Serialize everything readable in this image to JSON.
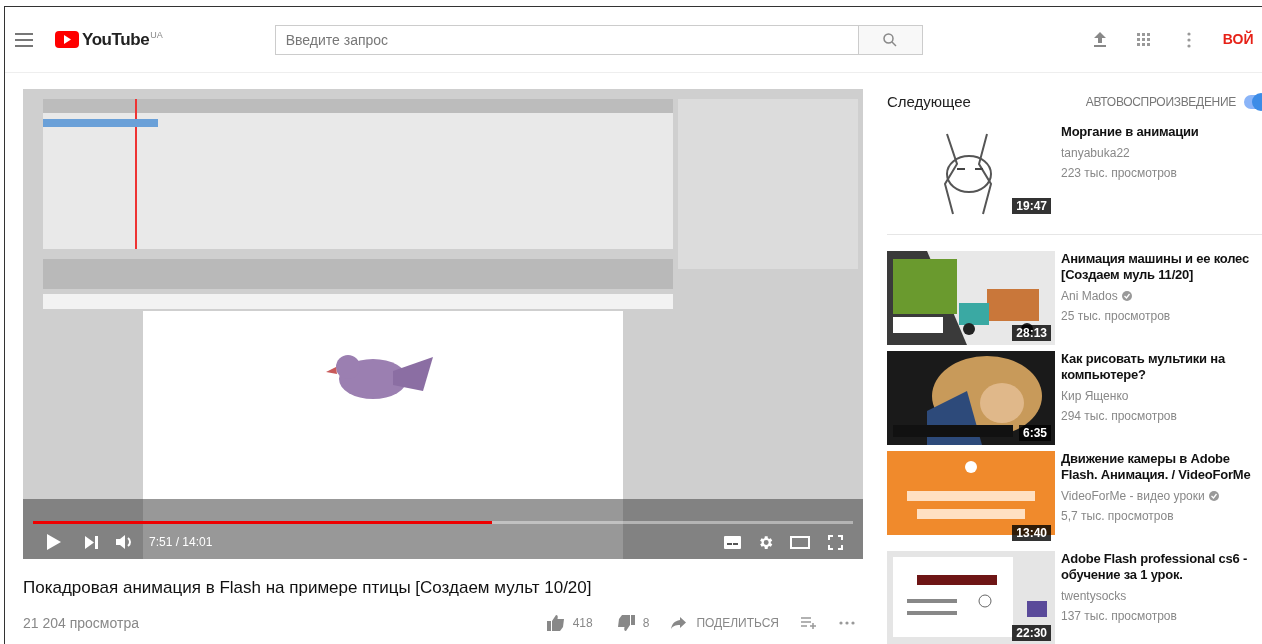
{
  "header": {
    "logo_text": "YouTube",
    "logo_region": "UA",
    "search": {
      "placeholder": "Введите запрос"
    },
    "sign_in": "ВОЙ"
  },
  "player": {
    "progress": {
      "level": 0.56
    },
    "time": "7:51 / 14:01"
  },
  "video": {
    "title": "Покадровая анимация в Flash на примере птицы [Создаем мульт 10/20]",
    "views": "21 204 просмотра",
    "likes": "418",
    "dislikes": "8",
    "share": "ПОДЕЛИТЬСЯ"
  },
  "sidebar": {
    "heading": "Следующее",
    "autoplay": {
      "label": "АВТОВОСПРОИЗВЕДЕНИЕ",
      "on": true
    },
    "items": [
      {
        "title": "Моргание в анимации",
        "channel": "tanyabuka22",
        "verified": false,
        "views": "223 тыс. просмотров",
        "duration": "19:47"
      },
      {
        "title": "Анимация машины и ее колес [Создаем муль 11/20]",
        "channel": "Ani Mados",
        "verified": true,
        "views": "25 тыс. просмотров",
        "duration": "28:13"
      },
      {
        "title": "Как рисовать мультики на компьютере?",
        "channel": "Кир Ященко",
        "verified": false,
        "views": "294 тыс. просмотров",
        "duration": "6:35"
      },
      {
        "title": "Движение камеры в Adobe Flash. Анимация. / VideoForMe",
        "channel": "VideoForMe - видео уроки",
        "verified": true,
        "views": "5,7 тыс. просмотров",
        "duration": "13:40"
      },
      {
        "title": "Adobe Flash professional cs6 - обучение за 1 урок.",
        "channel": "twentysocks",
        "verified": false,
        "views": "137 тыс. просмотров",
        "duration": "22:30"
      }
    ]
  }
}
